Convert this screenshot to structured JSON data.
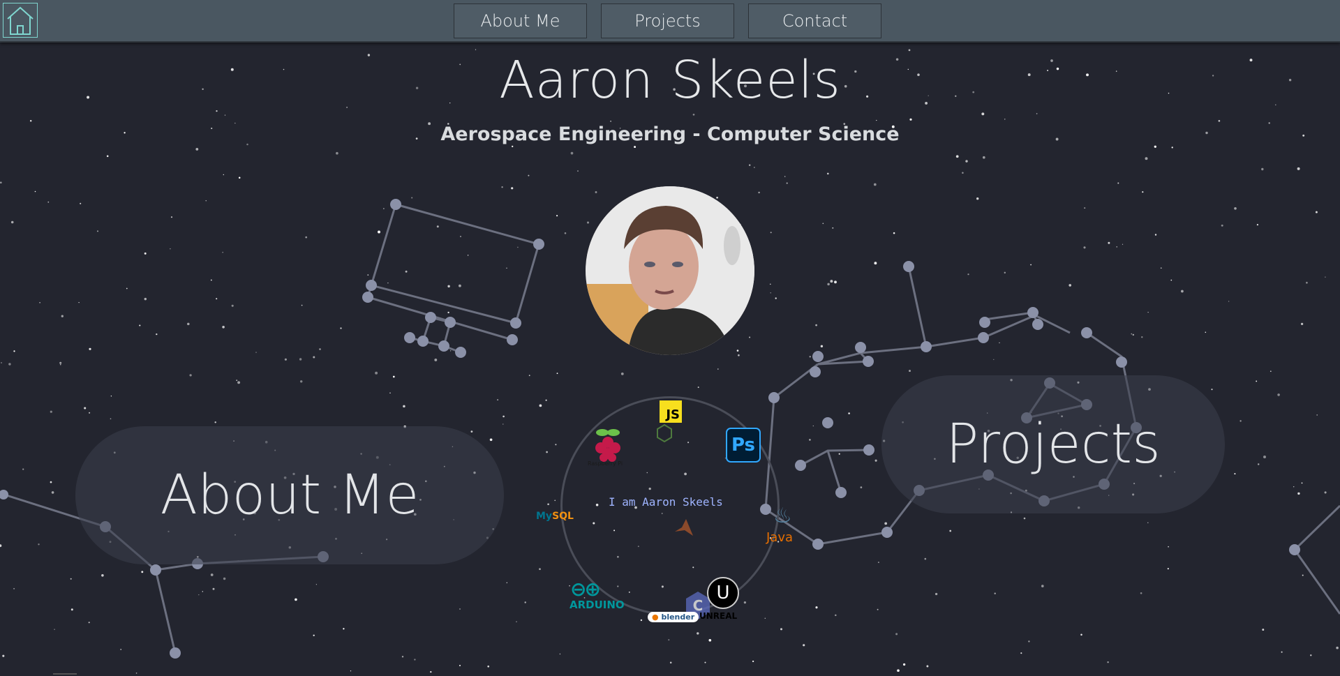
{
  "nav": {
    "home_icon": "house-icon",
    "items": [
      {
        "label": "About Me"
      },
      {
        "label": "Projects"
      },
      {
        "label": "Contact"
      }
    ]
  },
  "hero": {
    "name": "Aaron Skeels",
    "subtitle": "Aerospace Engineering - Computer Science"
  },
  "sections": {
    "about": "About Me",
    "projects": "Projects"
  },
  "skills": {
    "intro": "I am Aaron Skeels",
    "logos": {
      "js": "JS",
      "ps": "Ps",
      "raspberry": "Raspberry Pi",
      "mysql_a": "My",
      "mysql_b": "SQL",
      "java": "Java",
      "arduino_symbol": "⊖⊕",
      "arduino": "ARDUINO",
      "blender_a": "●",
      "blender_b": "blender",
      "unreal": "U",
      "unreal_text": "UNREAL",
      "c": "C"
    }
  },
  "colors": {
    "background": "#23252f",
    "navbar": "#4a5761",
    "accent": "#7fd6cf",
    "constellation": "#8b91a8"
  }
}
